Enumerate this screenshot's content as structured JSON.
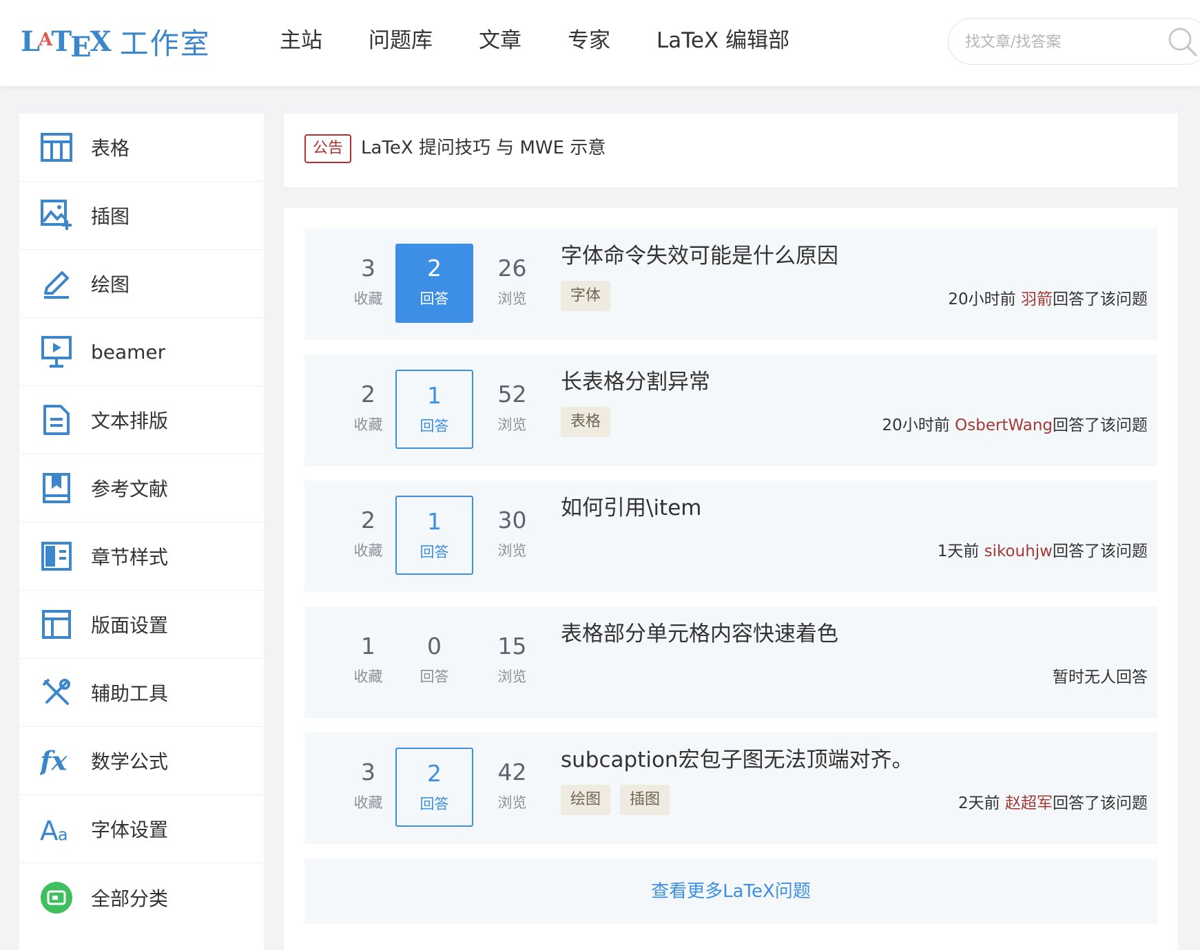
{
  "header": {
    "logo_text": "工作室",
    "nav": [
      "主站",
      "问题库",
      "文章",
      "专家",
      "LaTeX 编辑部"
    ],
    "search_placeholder": "找文章/找答案"
  },
  "sidebar": {
    "items": [
      {
        "label": "表格",
        "icon": "table-icon"
      },
      {
        "label": "插图",
        "icon": "image-add-icon"
      },
      {
        "label": "绘图",
        "icon": "pencil-icon"
      },
      {
        "label": "beamer",
        "icon": "presentation-icon"
      },
      {
        "label": "文本排版",
        "icon": "document-icon"
      },
      {
        "label": "参考文献",
        "icon": "bookmark-book-icon"
      },
      {
        "label": "章节样式",
        "icon": "layout-columns-icon"
      },
      {
        "label": "版面设置",
        "icon": "page-layout-icon"
      },
      {
        "label": "辅助工具",
        "icon": "tools-icon"
      },
      {
        "label": "数学公式",
        "icon": "fx-icon"
      },
      {
        "label": "字体设置",
        "icon": "font-icon"
      },
      {
        "label": "全部分类",
        "icon": "all-categories-icon"
      }
    ]
  },
  "notice": {
    "badge": "公告",
    "title": "LaTeX 提问技巧 与 MWE 示意"
  },
  "stat_labels": {
    "fav": "收藏",
    "ans": "回答",
    "view": "浏览"
  },
  "questions": [
    {
      "fav": "3",
      "ans": "2",
      "view": "26",
      "title": "字体命令失效可能是什么原因",
      "tags": [
        "字体"
      ],
      "time": "20小时前",
      "user": "羽箭",
      "suffix": "回答了该问题",
      "style": "filled"
    },
    {
      "fav": "2",
      "ans": "1",
      "view": "52",
      "title": "长表格分割异常",
      "tags": [
        "表格"
      ],
      "time": "20小时前",
      "user": "OsbertWang",
      "suffix": "回答了该问题",
      "style": "outlined"
    },
    {
      "fav": "2",
      "ans": "1",
      "view": "30",
      "title": "如何引用\\item",
      "tags": [],
      "time": "1天前",
      "user": "sikouhjw",
      "suffix": "回答了该问题",
      "style": "outlined"
    },
    {
      "fav": "1",
      "ans": "0",
      "view": "15",
      "title": "表格部分单元格内容快速着色",
      "tags": [],
      "time": "",
      "user": "",
      "suffix": "暂时无人回答",
      "style": "plain"
    },
    {
      "fav": "3",
      "ans": "2",
      "view": "42",
      "title": "subcaption宏包子图无法顶端对齐。",
      "tags": [
        "绘图",
        "插图"
      ],
      "time": "2天前",
      "user": "赵超军",
      "suffix": "回答了该问题",
      "style": "outlined"
    }
  ],
  "more_link": "查看更多LaTeX问题",
  "colors": {
    "accent": "#3d8fe6",
    "user": "#a33a34",
    "badge": "#b0302a",
    "icon": "#3c86cc"
  }
}
